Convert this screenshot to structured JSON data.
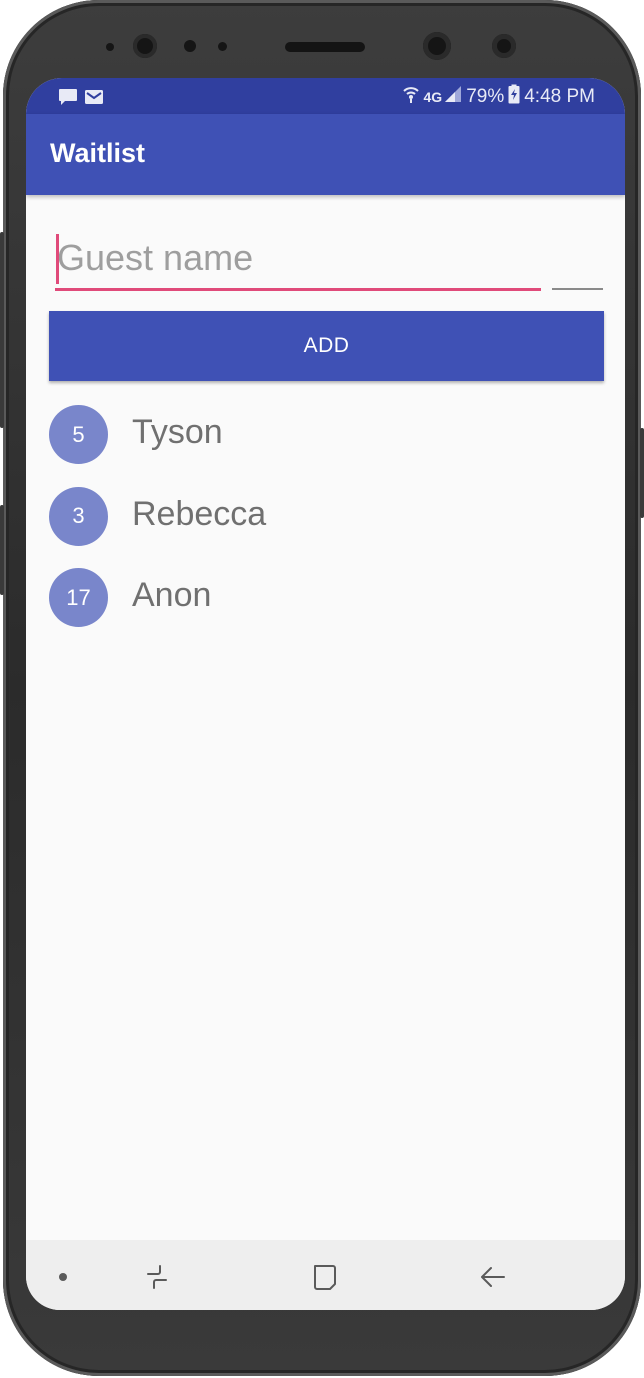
{
  "status_bar": {
    "battery_percent": "79%",
    "time": "4:48 PM",
    "network": "4G",
    "notification_icons": [
      "message-icon",
      "mail-icon"
    ]
  },
  "app_bar": {
    "title": "Waitlist"
  },
  "form": {
    "guest_name_placeholder": "Guest name",
    "guest_name_value": "",
    "party_size_value": "",
    "add_button_label": "ADD"
  },
  "guests": [
    {
      "party_size": "5",
      "name": "Tyson"
    },
    {
      "party_size": "3",
      "name": "Rebecca"
    },
    {
      "party_size": "17",
      "name": "Anon"
    }
  ],
  "colors": {
    "primary": "#3f51b5",
    "primary_dark": "#303f9f",
    "accent": "#e04a7a",
    "badge": "#7986cb"
  },
  "nav_bar": {
    "items": [
      "dot-icon",
      "recent-apps-icon",
      "home-icon",
      "back-icon"
    ]
  }
}
